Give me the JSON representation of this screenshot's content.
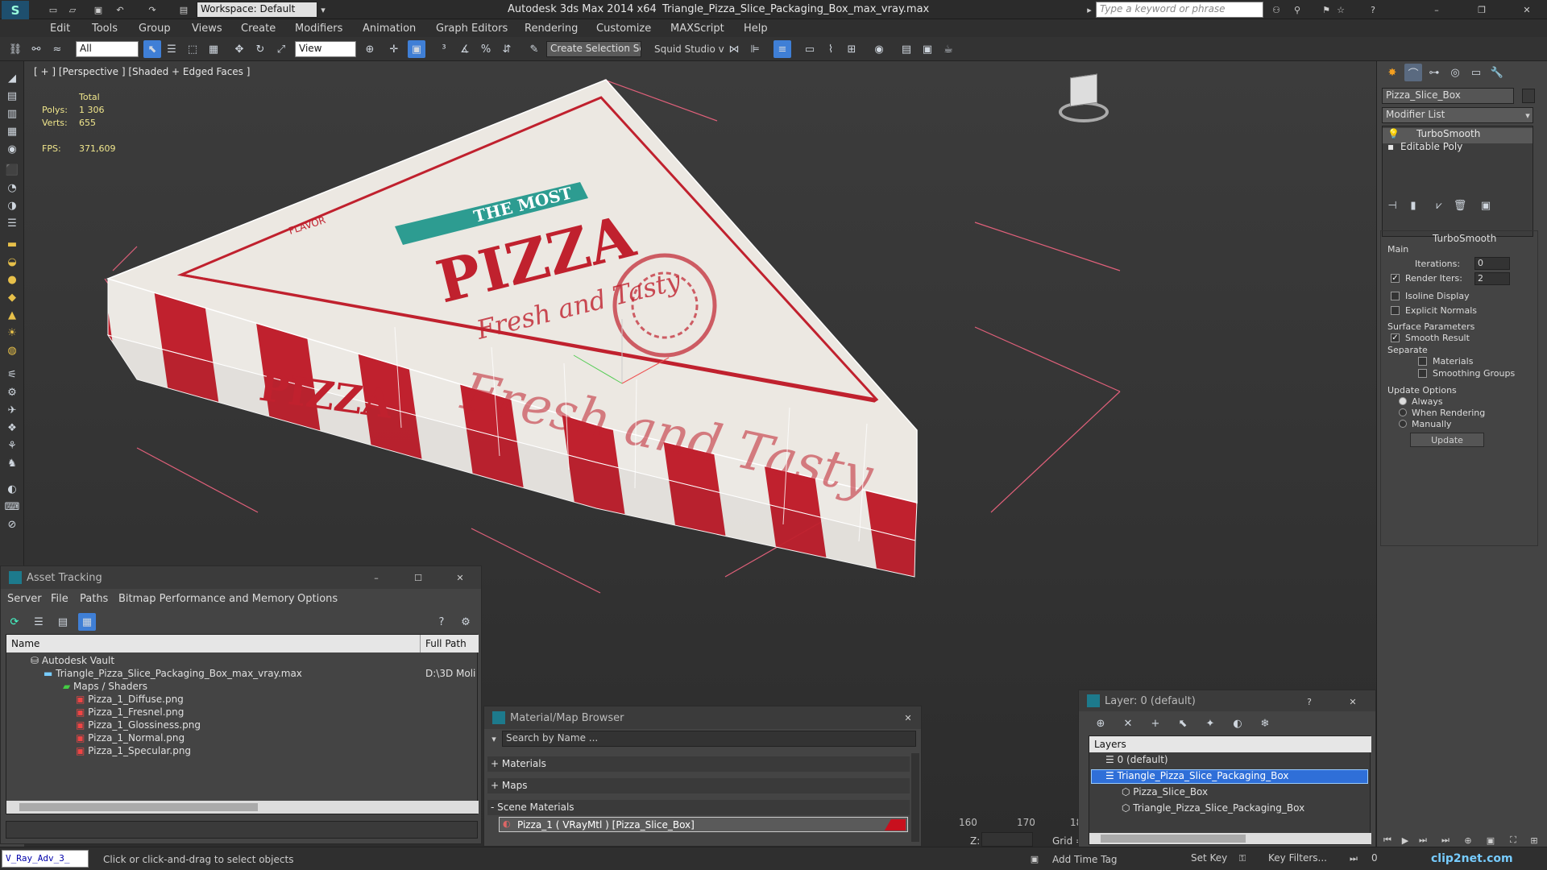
{
  "titlebar": {
    "workspace": "Workspace: Default",
    "app": "Autodesk 3ds Max  2014 x64",
    "file": "Triangle_Pizza_Slice_Packaging_Box_max_vray.max",
    "search_placeholder": "Type a keyword or phrase"
  },
  "menu": [
    "Edit",
    "Tools",
    "Group",
    "Views",
    "Create",
    "Modifiers",
    "Animation",
    "Graph Editors",
    "Rendering",
    "Customize",
    "MAXScript",
    "Help"
  ],
  "toolbar": {
    "filter": "All",
    "ref_coord": "View",
    "selection_set": "Create Selection Se",
    "studio": "Squid Studio v"
  },
  "viewport": {
    "label": "[ + ] [Perspective ] [Shaded + Edged Faces ]",
    "stats": {
      "total_label": "Total",
      "polys_label": "Polys:",
      "polys_value": "1 306",
      "verts_label": "Verts:",
      "verts_value": "655",
      "fps_label": "FPS:",
      "fps_value": "371,609"
    },
    "box_text": {
      "pizza": "PIZZA",
      "the_most": "THE MOST",
      "fresh": "Fresh and Tasty",
      "side_pizza": "PIZZA",
      "side_fresh": "Fresh and Tasty",
      "flavor": "FLAVOR"
    }
  },
  "command_panel": {
    "object_name": "Pizza_Slice_Box",
    "modifier_list": "Modifier List",
    "stack": [
      "TurboSmooth",
      "Editable Poly"
    ],
    "turbosmooth": {
      "title": "TurboSmooth",
      "main": "Main",
      "iterations_label": "Iterations:",
      "iterations": "0",
      "render_iters_label": "Render Iters:",
      "render_iters": "2",
      "isoline": "Isoline Display",
      "explicit": "Explicit Normals",
      "surface_params": "Surface Parameters",
      "smooth_result": "Smooth Result",
      "separate": "Separate",
      "materials": "Materials",
      "smoothing_groups": "Smoothing Groups",
      "update_options": "Update Options",
      "always": "Always",
      "when_rendering": "When Rendering",
      "manually": "Manually",
      "update": "Update"
    }
  },
  "asset_tracking": {
    "title": "Asset Tracking",
    "menu": [
      "Server",
      "File",
      "Paths",
      "Bitmap Performance and Memory",
      "Options"
    ],
    "col_name": "Name",
    "col_path": "Full Path",
    "rows": [
      {
        "name": "Autodesk Vault",
        "path": ""
      },
      {
        "name": "Triangle_Pizza_Slice_Packaging_Box_max_vray.max",
        "path": "D:\\3D Moli"
      },
      {
        "name": "Maps / Shaders",
        "path": ""
      },
      {
        "name": "Pizza_1_Diffuse.png",
        "path": ""
      },
      {
        "name": "Pizza_1_Fresnel.png",
        "path": ""
      },
      {
        "name": "Pizza_1_Glossiness.png",
        "path": ""
      },
      {
        "name": "Pizza_1_Normal.png",
        "path": ""
      },
      {
        "name": "Pizza_1_Specular.png",
        "path": ""
      }
    ]
  },
  "material_browser": {
    "title": "Material/Map Browser",
    "search": "Search by Name ...",
    "sections": [
      "+ Materials",
      "+ Maps",
      "- Scene Materials"
    ],
    "material": "Pizza_1  ( VRayMtl )  [Pizza_Slice_Box]"
  },
  "layer": {
    "title": "Layer: 0 (default)",
    "header": "Layers",
    "rows": [
      "0 (default)",
      "Triangle_Pizza_Slice_Packaging_Box",
      "Pizza_Slice_Box",
      "Triangle_Pizza_Slice_Packaging_Box"
    ]
  },
  "timeline": {
    "ticks": [
      "160",
      "170",
      "18"
    ],
    "z_label": "Z:",
    "grid_label": "Grid ="
  },
  "status": {
    "script": "V_Ray_Adv_3_",
    "prompt": "Click or click-and-drag to select objects",
    "add_time_tag": "Add Time Tag",
    "set_key": "Set Key",
    "key_filters": "Key Filters...",
    "frame": "0",
    "watermark": "clip2net.com"
  },
  "colors": {
    "accent": "#2f6fd8",
    "box_red": "#c0212e",
    "teal": "#2d9c91"
  }
}
